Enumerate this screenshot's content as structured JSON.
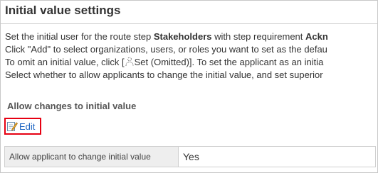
{
  "page": {
    "title": "Initial value settings"
  },
  "description": {
    "line1_pre": "Set the initial user for the route step ",
    "line1_bold1": "Stakeholders",
    "line1_mid": " with step requirement ",
    "line1_bold2": "Ackn",
    "line2": "Click \"Add\" to select organizations, users, or roles you want to set as the defau",
    "line3_pre": "To omit an initial value, click [",
    "line3_icon": "person-icon",
    "line3_post": "Set (Omitted)]. To set the applicant as an initia",
    "line4": "Select whether to allow applicants to change the initial value, and set superior"
  },
  "section": {
    "heading": "Allow changes to initial value",
    "edit_label": "Edit",
    "edit_icon": "edit-icon",
    "highlight_color": "#e60012"
  },
  "settings": {
    "row_label": "Allow applicant to change initial value",
    "row_value": "Yes"
  }
}
